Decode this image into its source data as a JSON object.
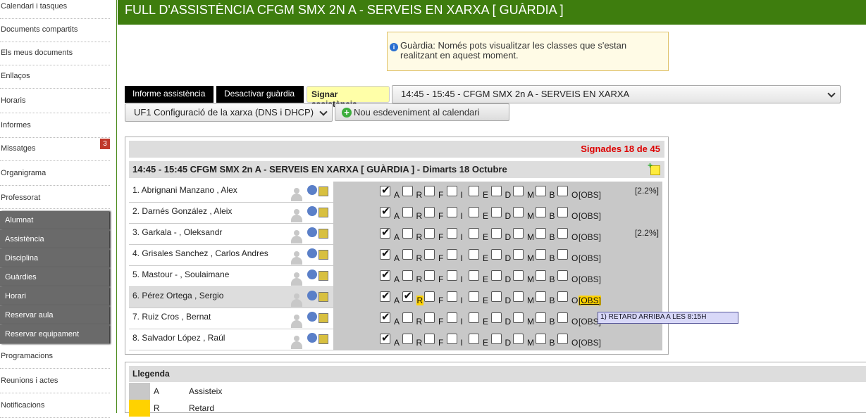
{
  "sidebar": {
    "links_top": [
      "Calendari i tasques",
      "Documents compartits",
      "Els meus documents",
      "Enllaços",
      "Horaris",
      "Informes",
      "Missatges",
      "Organigrama",
      "Professorat"
    ],
    "messages_badge": "3",
    "submenu": [
      "Alumnat",
      "Assistència",
      "Disciplina",
      "Guàrdies",
      "Horari",
      "Reservar aula",
      "Reservar equipament"
    ],
    "links_bottom": [
      "Programacions",
      "Reunions i actes",
      "Notificacions"
    ]
  },
  "header": {
    "title": "FULL D'ASSISTÈNCIA CFGM SMX 2N A - SERVEIS EN XARXA [ GUÀRDIA ]"
  },
  "notice": {
    "text": "Guàrdia: Només pots visualitzar les classes que s'estan realitzant en aquest moment."
  },
  "toolbar": {
    "report_label": "Informe assistència",
    "disable_guard_label": "Desactivar guàrdia",
    "sign_label": "Signar assistència",
    "class_select": "14:45 - 15:45 - CFGM SMX 2n A - SERVEIS EN XARXA",
    "unit_select": "UF1 Configuració de la xarxa (DNS i DHCP)",
    "new_event_label": "Nou esdeveniment al calendari"
  },
  "panel": {
    "signed": "Signades 18 de 45",
    "class_title": "14:45 - 15:45 CFGM SMX 2n A - SERVEIS EN XARXA [ GUÀRDIA ] - Dimarts 18  Octubre",
    "codes": [
      "A",
      "R",
      "F",
      "I",
      "E",
      "D",
      "M",
      "B",
      "O"
    ],
    "obs_label": "[OBS]",
    "students": [
      {
        "name": "1. Abrignani Manzano , Alex",
        "checked": [
          "A"
        ],
        "pct": "[2.2%]"
      },
      {
        "name": "2. Darnés González , Aleix",
        "checked": [
          "A"
        ],
        "pct": ""
      },
      {
        "name": "3. Garkala - , Oleksandr",
        "checked": [
          "A"
        ],
        "pct": "[2.2%]"
      },
      {
        "name": "4. Grisales Sanchez , Carlos Andres",
        "checked": [
          "A"
        ],
        "pct": ""
      },
      {
        "name": "5. Mastour - , Soulaimane",
        "checked": [
          "A"
        ],
        "pct": ""
      },
      {
        "name": "6. Pérez Ortega , Sergio",
        "checked": [
          "A",
          "R"
        ],
        "pct": "",
        "highlight": true
      },
      {
        "name": "7. Ruiz Cros , Bernat",
        "checked": [
          "A"
        ],
        "pct": ""
      },
      {
        "name": "8. Salvador López , Raúl",
        "checked": [
          "A"
        ],
        "pct": ""
      }
    ],
    "tooltip": "1) RETARD ARRIBA A LES 8:15H"
  },
  "legend": {
    "title": "Llegenda",
    "items": [
      {
        "code": "A",
        "name": "Assisteix",
        "color": "#c8c8c8"
      },
      {
        "code": "R",
        "name": "Retard",
        "color": "#ffd200"
      }
    ]
  }
}
